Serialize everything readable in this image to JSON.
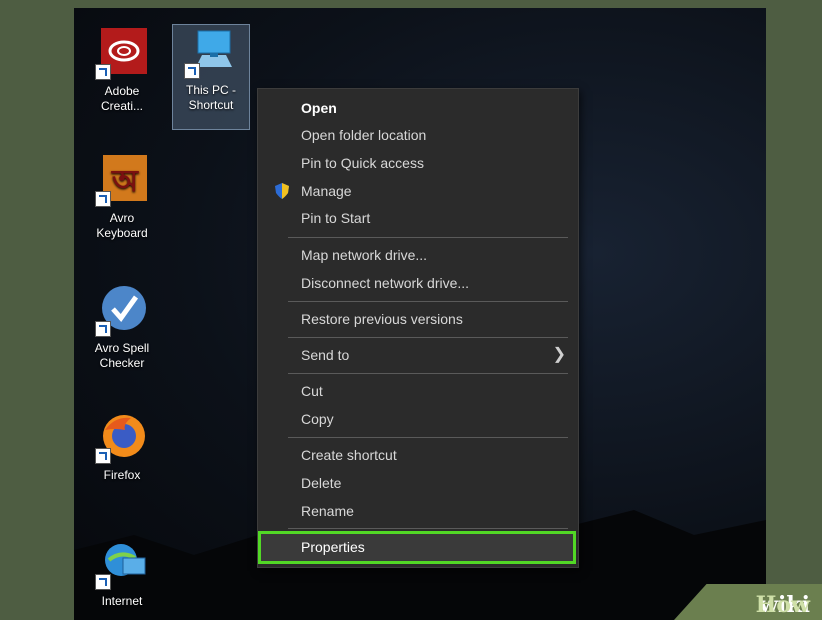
{
  "desktop_icons": [
    {
      "id": "adobe",
      "label": "Adobe\nCreati...",
      "icon": "adobe-cc-icon"
    },
    {
      "id": "thispc",
      "label": "This PC -\nShortcut",
      "icon": "this-pc-icon"
    },
    {
      "id": "avro",
      "label": "Avro\nKeyboard",
      "icon": "avro-keyboard-icon"
    },
    {
      "id": "avrospell",
      "label": "Avro Spell\nChecker",
      "icon": "avro-spell-checker-icon"
    },
    {
      "id": "firefox",
      "label": "Firefox",
      "icon": "firefox-icon"
    },
    {
      "id": "ie",
      "label": "Internet",
      "icon": "internet-explorer-icon"
    }
  ],
  "context_menu": {
    "items": [
      {
        "label": "Open"
      },
      {
        "label": "Open folder location"
      },
      {
        "label": "Pin to Quick access"
      },
      {
        "label": "Manage",
        "icon": "admin-shield-icon"
      },
      {
        "label": "Pin to Start"
      },
      {
        "label": "Map network drive..."
      },
      {
        "label": "Disconnect network drive..."
      },
      {
        "label": "Restore previous versions"
      },
      {
        "label": "Send to",
        "submenu_icon": "chevron-right-icon"
      },
      {
        "label": "Cut"
      },
      {
        "label": "Copy"
      },
      {
        "label": "Create shortcut"
      },
      {
        "label": "Delete"
      },
      {
        "label": "Rename"
      },
      {
        "label": "Properties",
        "highlighted": true
      }
    ]
  },
  "watermark": {
    "wiki": "wiki",
    "how": "How"
  },
  "colors": {
    "highlight_border": "#52d826",
    "menu_bg": "#2b2b2b"
  }
}
